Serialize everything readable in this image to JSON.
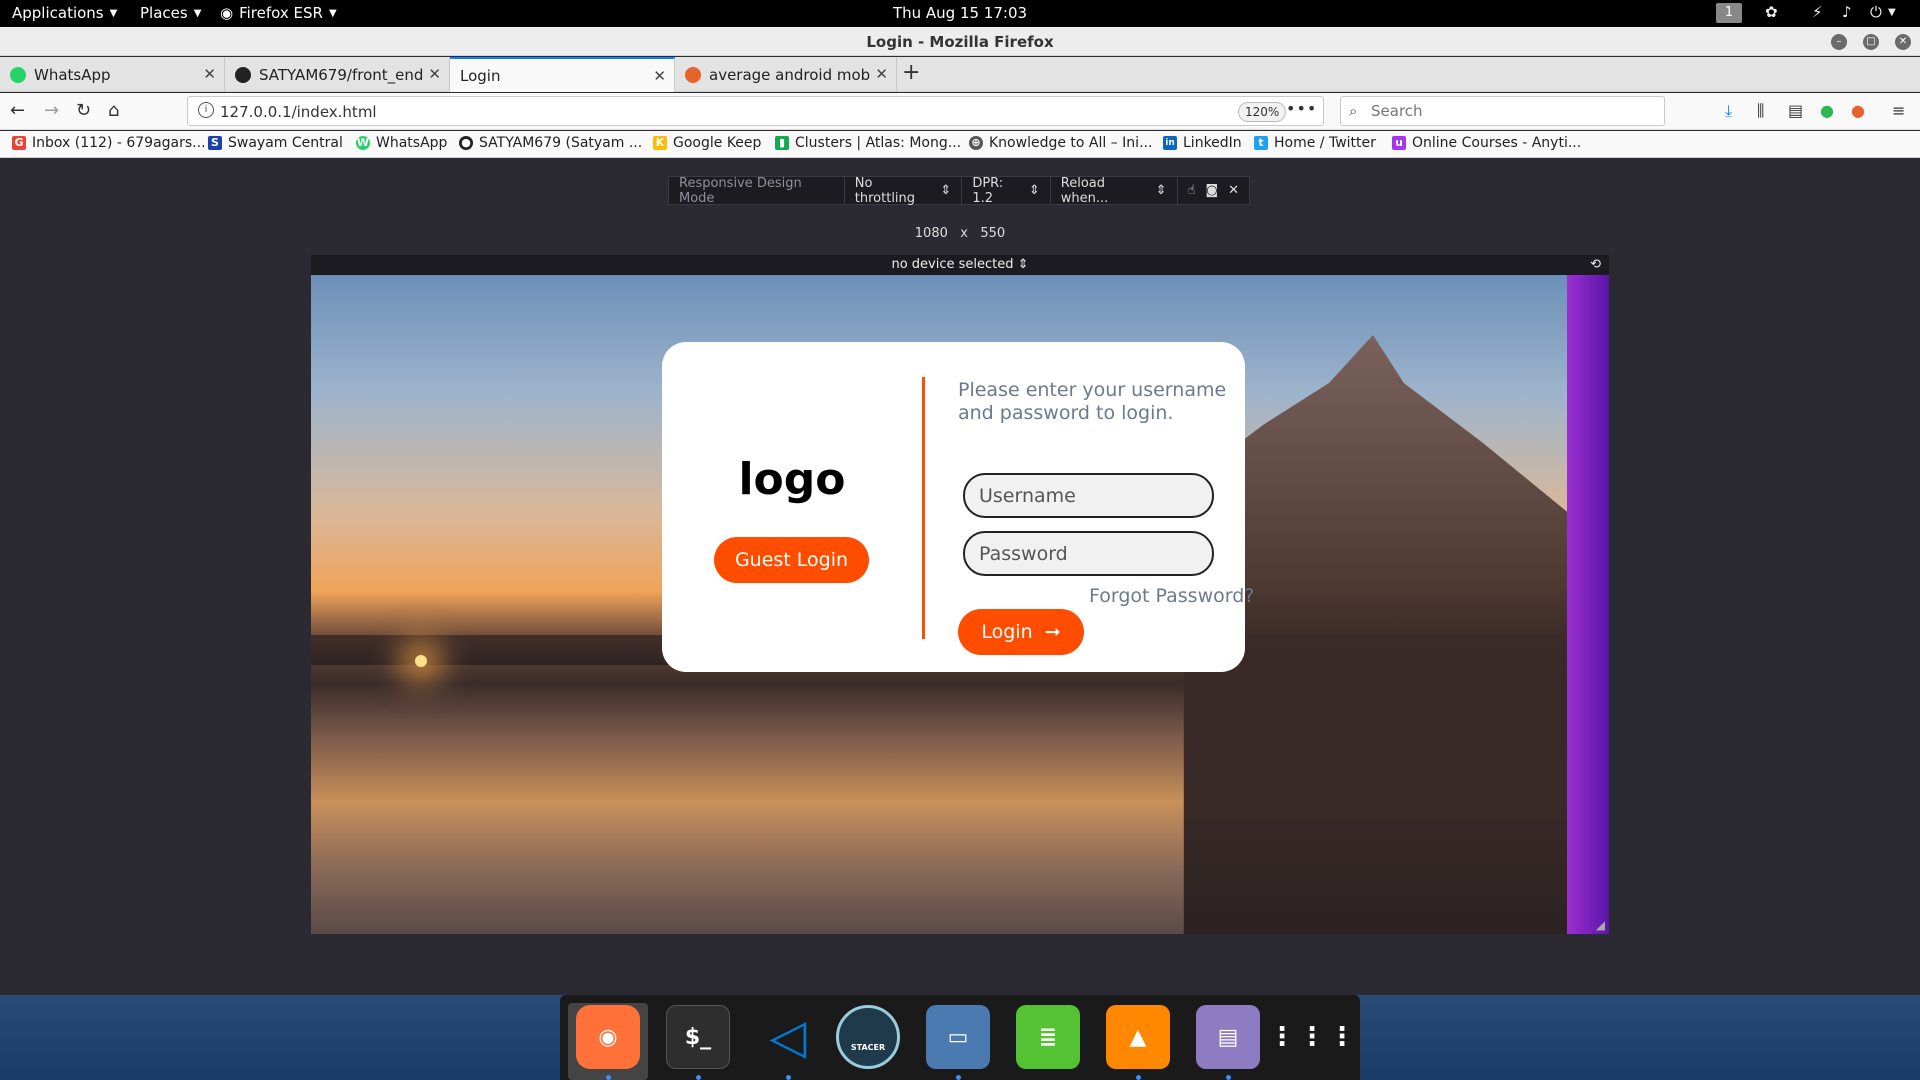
{
  "topbar": {
    "applications": "Applications",
    "places": "Places",
    "firefox": "Firefox ESR",
    "clock": "Thu Aug 15  17:03",
    "workspace": "1"
  },
  "window": {
    "title": "Login - Mozilla Firefox"
  },
  "tabs": [
    {
      "label": "WhatsApp",
      "color": "#25d366"
    },
    {
      "label": "SATYAM679/front_end",
      "color": "#222222"
    },
    {
      "label": "Login",
      "color": "#0a84ff"
    },
    {
      "label": "average android mobile",
      "color": "#e8622c"
    }
  ],
  "navbar": {
    "url": "127.0.0.1/index.html",
    "zoom": "120%",
    "search_placeholder": "Search"
  },
  "bookmarks": [
    {
      "label": "Inbox (112) - 679agars...",
      "icon": "G",
      "color": "#ea4335"
    },
    {
      "label": "Swayam Central",
      "icon": "S",
      "color": "#1e40af"
    },
    {
      "label": "WhatsApp",
      "icon": "W",
      "color": "#25d366"
    },
    {
      "label": "SATYAM679 (Satyam ...",
      "icon": "●",
      "color": "#222222"
    },
    {
      "label": "Google Keep",
      "icon": "K",
      "color": "#fbbc04"
    },
    {
      "label": "Clusters | Atlas: Mong...",
      "icon": "▮",
      "color": "#13aa52"
    },
    {
      "label": "Knowledge to All – Ini...",
      "icon": "⊕",
      "color": "#555555"
    },
    {
      "label": "LinkedIn",
      "icon": "in",
      "color": "#0a66c2"
    },
    {
      "label": "Home / Twitter",
      "icon": "t",
      "color": "#1da1f2"
    },
    {
      "label": "Online Courses - Anyti...",
      "icon": "u",
      "color": "#a435f0"
    }
  ],
  "rdm": {
    "label": "Responsive Design Mode",
    "throttle": "No throttling",
    "dpr": "DPR: 1.2",
    "reload": "Reload when...",
    "width": "1080",
    "times": "x",
    "height": "550",
    "device": "no device selected"
  },
  "login": {
    "logo": "logo",
    "guest_button": "Guest Login",
    "prompt": "Please enter your username and password to login.",
    "username_placeholder": "Username",
    "password_placeholder": "Password",
    "forgot": "Forgot Password?",
    "login_button": "Login",
    "accent": "#ff4d00"
  },
  "dock": [
    {
      "name": "firefox",
      "label": "",
      "color": "#ff7139"
    },
    {
      "name": "terminal",
      "label": "$_",
      "color": "#2e2e2e"
    },
    {
      "name": "vscode",
      "label": "",
      "color": "#0078d4"
    },
    {
      "name": "stacer",
      "label": "STACER",
      "color": "#1f3a4a"
    },
    {
      "name": "files",
      "label": "",
      "color": "#4a7ab0"
    },
    {
      "name": "notes",
      "label": "",
      "color": "#55c233"
    },
    {
      "name": "vlc",
      "label": "",
      "color": "#ff8800"
    },
    {
      "name": "text-editor",
      "label": "",
      "color": "#8e7cc3"
    },
    {
      "name": "app-grid",
      "label": "",
      "color": "#1a1a1a"
    }
  ]
}
